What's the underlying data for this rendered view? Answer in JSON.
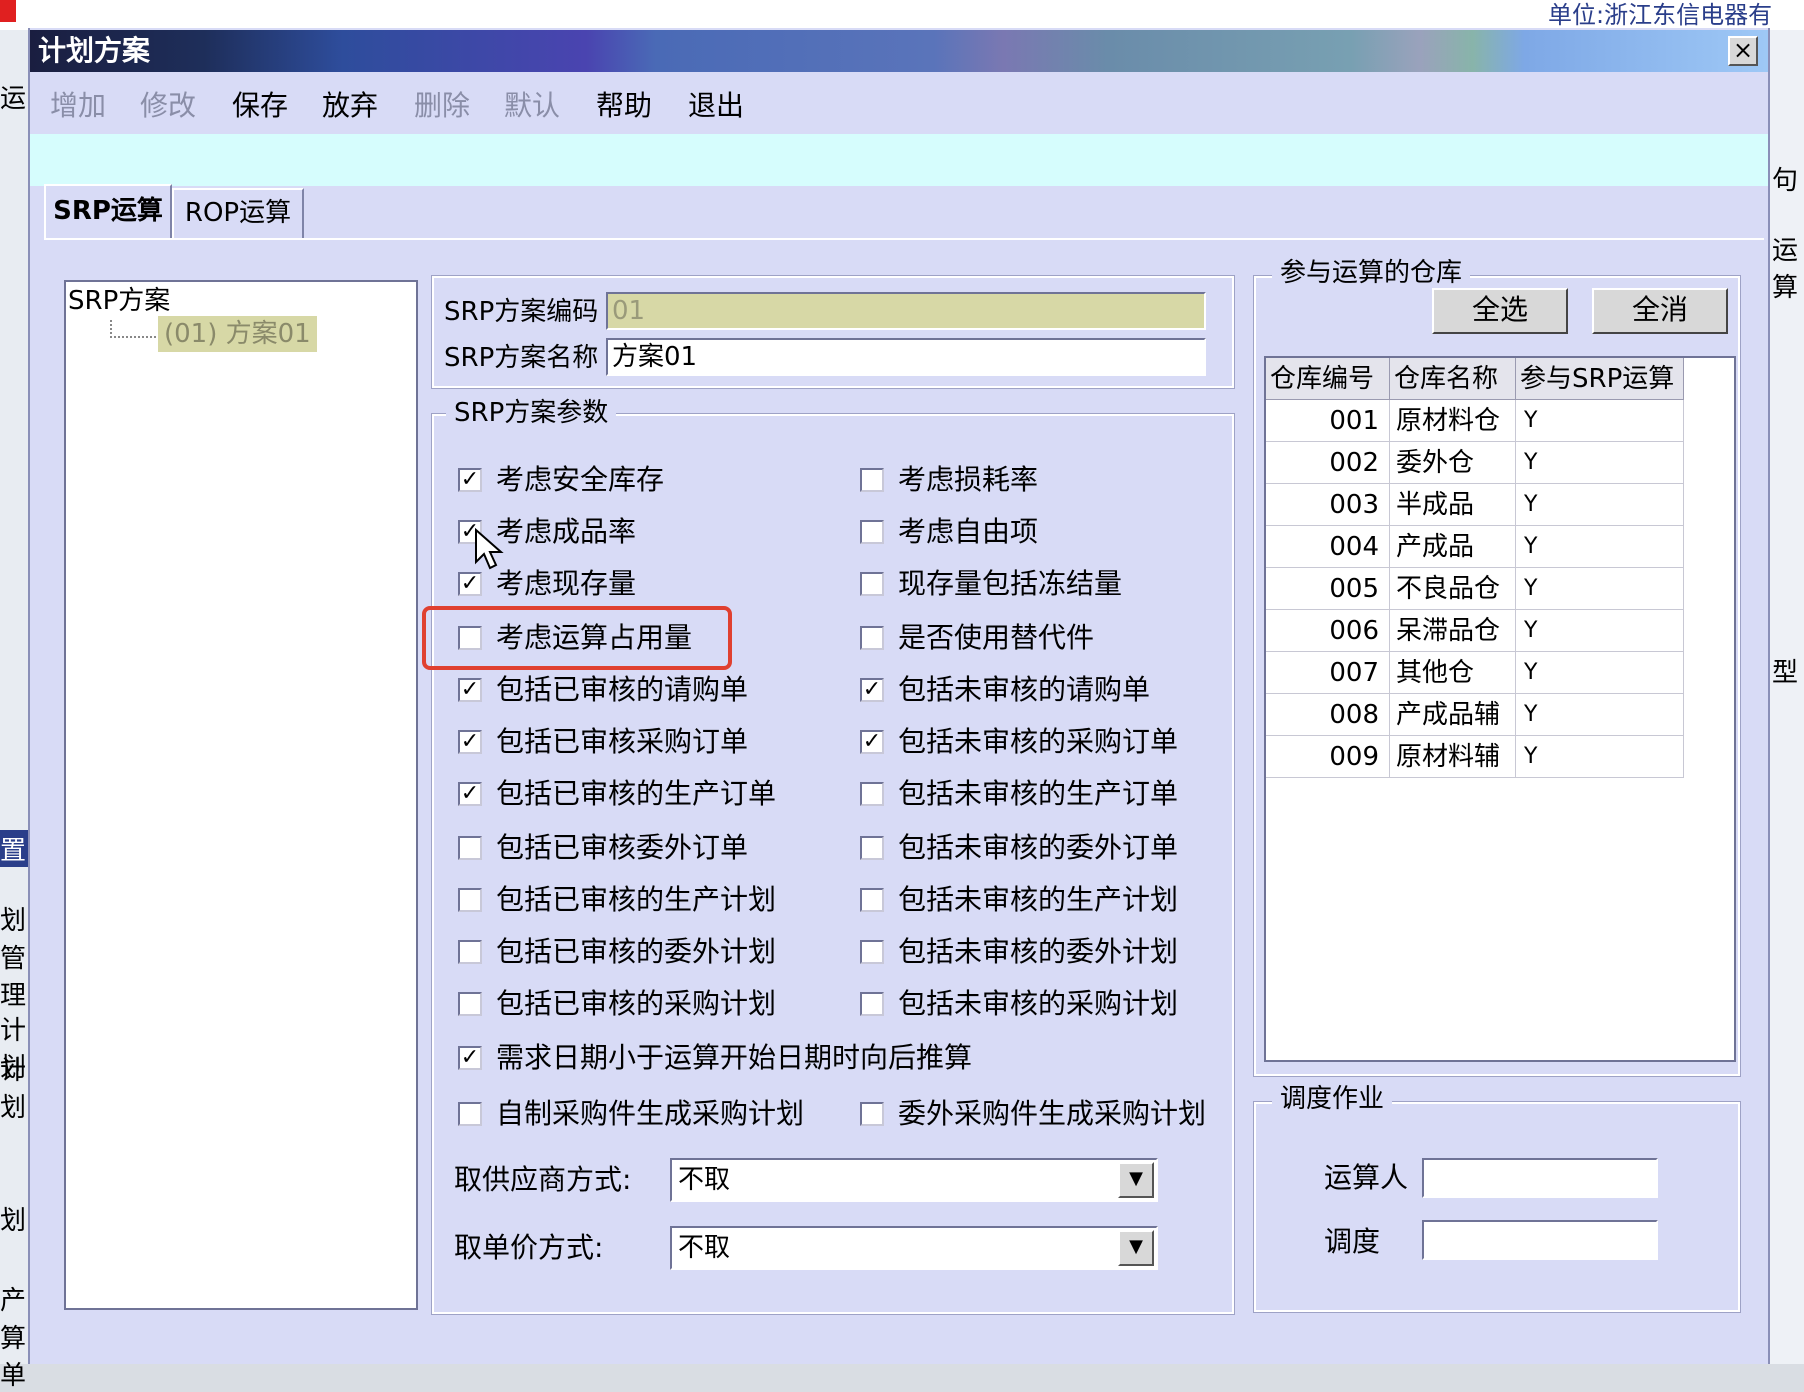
{
  "background": {
    "top_fragment": "单位:浙江东信电器有",
    "right_fragments": [
      "句",
      "运算",
      "型",
      "运"
    ],
    "left_fragments": [
      "运",
      "置",
      "划",
      "管理",
      "计划",
      "计划",
      "划",
      "产",
      "算单"
    ]
  },
  "window": {
    "title": "计划方案",
    "close_label": "×"
  },
  "toolbar": {
    "add": "增加",
    "edit": "修改",
    "save": "保存",
    "discard": "放弃",
    "delete": "删除",
    "default": "默认",
    "help": "帮助",
    "exit": "退出"
  },
  "tabs": {
    "srp": "SRP运算",
    "rop": "ROP运算"
  },
  "tree": {
    "root": "SRP方案",
    "child": "(01) 方案01"
  },
  "scheme": {
    "code_label": "SRP方案编码",
    "code_value": "01",
    "name_label": "SRP方案名称",
    "name_value": "方案01"
  },
  "params": {
    "group_title": "SRP方案参数",
    "left_options": [
      {
        "label": "考虑安全库存",
        "checked": true
      },
      {
        "label": "考虑成品率",
        "checked": true
      },
      {
        "label": "考虑现存量",
        "checked": true
      },
      {
        "label": "考虑运算占用量",
        "checked": false
      },
      {
        "label": "包括已审核的请购单",
        "checked": true
      },
      {
        "label": "包括已审核采购订单",
        "checked": true
      },
      {
        "label": "包括已审核的生产订单",
        "checked": true
      },
      {
        "label": "包括已审核委外订单",
        "checked": false
      },
      {
        "label": "包括已审核的生产计划",
        "checked": false
      },
      {
        "label": "包括已审核的委外计划",
        "checked": false
      },
      {
        "label": "包括已审核的采购计划",
        "checked": false
      }
    ],
    "right_options": [
      {
        "label": "考虑损耗率",
        "checked": false
      },
      {
        "label": "考虑自由项",
        "checked": false
      },
      {
        "label": "现存量包括冻结量",
        "checked": false
      },
      {
        "label": "是否使用替代件",
        "checked": false
      },
      {
        "label": "包括未审核的请购单",
        "checked": true
      },
      {
        "label": "包括未审核的采购订单",
        "checked": true
      },
      {
        "label": "包括未审核的生产订单",
        "checked": false
      },
      {
        "label": "包括未审核的委外订单",
        "checked": false
      },
      {
        "label": "包括未审核的生产计划",
        "checked": false
      },
      {
        "label": "包括未审核的委外计划",
        "checked": false
      },
      {
        "label": "包括未审核的采购计划",
        "checked": false
      }
    ],
    "defer_option": {
      "label": "需求日期小于运算开始日期时向后推算",
      "checked": true
    },
    "self_made_option": {
      "label": "自制采购件生成采购计划",
      "checked": false
    },
    "outsource_option": {
      "label": "委外采购件生成采购计划",
      "checked": false
    },
    "supplier_label": "取供应商方式:",
    "supplier_value": "不取",
    "price_label": "取单价方式:",
    "price_value": "不取",
    "check_mark": "✓",
    "dropdown_glyph": "▼"
  },
  "warehouses": {
    "group_title": "参与运算的仓库",
    "select_all": "全选",
    "clear_all": "全消",
    "headers": [
      "仓库编号",
      "仓库名称",
      "参与SRP运算"
    ],
    "rows": [
      {
        "code": "001",
        "name": "原材料仓",
        "flag": "Y"
      },
      {
        "code": "002",
        "name": "委外仓",
        "flag": "Y"
      },
      {
        "code": "003",
        "name": "半成品",
        "flag": "Y"
      },
      {
        "code": "004",
        "name": "产成品",
        "flag": "Y"
      },
      {
        "code": "005",
        "name": "不良品仓",
        "flag": "Y"
      },
      {
        "code": "006",
        "name": "呆滞品仓",
        "flag": "Y"
      },
      {
        "code": "007",
        "name": "其他仓",
        "flag": "Y"
      },
      {
        "code": "008",
        "name": "产成品辅",
        "flag": "Y"
      },
      {
        "code": "009",
        "name": "原材料辅",
        "flag": "Y"
      }
    ]
  },
  "schedule": {
    "group_title": "调度作业",
    "operator_label": "运算人",
    "operator_value": "",
    "dispatch_label": "调度",
    "dispatch_value": ""
  },
  "colors": {
    "highlight": "#e04030",
    "window_bg": "#d8dbf6",
    "band": "#d6fdfd"
  }
}
